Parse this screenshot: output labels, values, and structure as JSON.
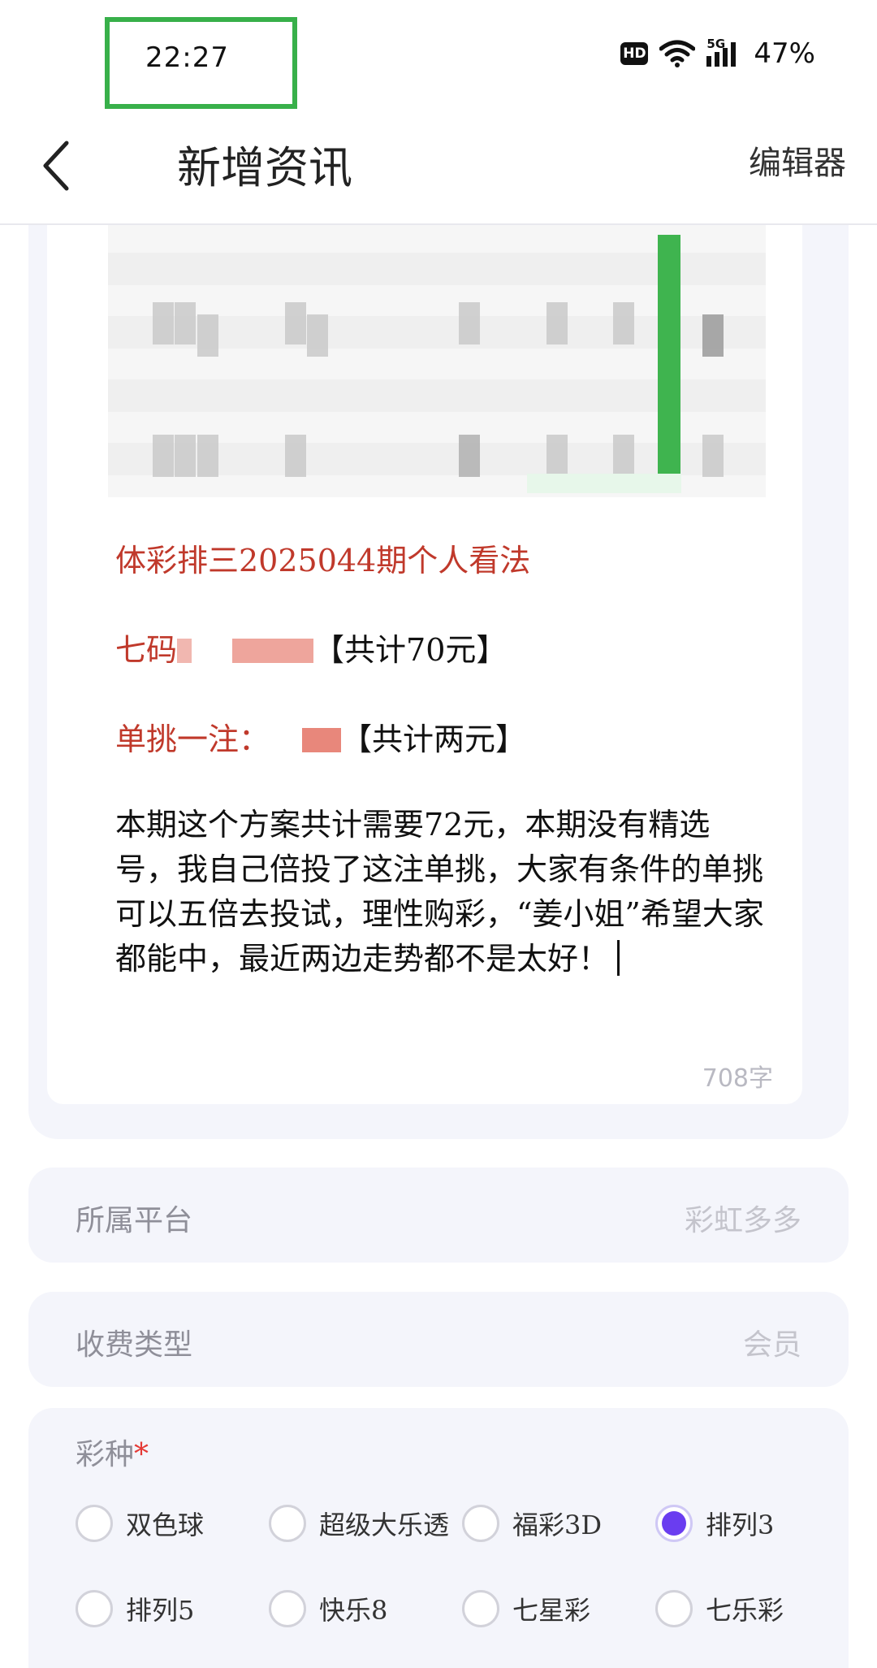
{
  "status_bar": {
    "time": "22:27",
    "hd": "HD",
    "network": "5G",
    "battery": "47%"
  },
  "header": {
    "title": "新增资讯",
    "editor_label": "编辑器"
  },
  "article": {
    "title_line": "体彩排三2025044期个人看法",
    "line2_prefix": "七码",
    "line2_suffix": "【共计70元】",
    "line3_prefix": "单挑一注：",
    "line3_suffix": "【共计两元】",
    "body": "本期这个方案共计需要72元，本期没有精选号，我自己倍投了这注单挑，大家有条件的单挑可以五倍去投试，理性购彩，“姜小姐”希望大家都能中，最近两边走势都不是太好！",
    "char_count": "708字"
  },
  "form": {
    "platform": {
      "label": "所属平台",
      "value": "彩虹多多"
    },
    "fee_type": {
      "label": "收费类型",
      "value": "会员"
    },
    "lottery": {
      "label": "彩种",
      "required_mark": "*",
      "options": [
        {
          "label": "双色球",
          "selected": false
        },
        {
          "label": "超级大乐透",
          "selected": false
        },
        {
          "label": "福彩3D",
          "selected": false
        },
        {
          "label": "排列3",
          "selected": true
        },
        {
          "label": "排列5",
          "selected": false
        },
        {
          "label": "快乐8",
          "selected": false
        },
        {
          "label": "七星彩",
          "selected": false
        },
        {
          "label": "七乐彩",
          "selected": false
        }
      ]
    }
  },
  "colors": {
    "accent_purple": "#6a3df0",
    "article_red": "#c0392b",
    "highlight_green": "#38b04a"
  }
}
